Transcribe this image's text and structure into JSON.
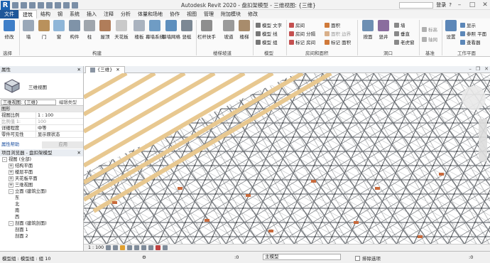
{
  "app": {
    "title": "Autodesk Revit 2020 - 盘扣架模型 - 三维视图: {三维}",
    "search_placeholder": "",
    "user": "登录",
    "help": "?"
  },
  "tabs": [
    "文件",
    "建筑",
    "结构",
    "钢",
    "系统",
    "插入",
    "注释",
    "分析",
    "体量和场地",
    "协作",
    "视图",
    "管理",
    "附加模块",
    "修改"
  ],
  "active_tab_index": 1,
  "ribbon": {
    "big_buttons": [
      "修改",
      "墙",
      "门",
      "窗",
      "构件",
      "柱",
      "屋顶",
      "天花板",
      "楼板",
      "幕墙系统",
      "幕墙网格",
      "竖梃",
      "栏杆扶手",
      "坡道",
      "楼梯",
      "按面",
      "竖井",
      "设置"
    ],
    "small_buttons": {
      "model": [
        "模型 文字",
        "模型 线",
        "模型 组"
      ],
      "room": [
        "房间",
        "房间 分隔",
        "标记 房间"
      ],
      "area": [
        "面积",
        "面积 边界",
        "标记 面积"
      ],
      "opening": [
        "墙",
        "垂直",
        "老虎窗"
      ],
      "datum": [
        "标高",
        "轴网"
      ],
      "workplane": [
        "显示",
        "参照 平面",
        "查看器"
      ]
    },
    "groups": [
      "选择",
      "构建",
      "楼梯坡道",
      "模型",
      "房间和面积",
      "洞口",
      "基准",
      "工作平面"
    ]
  },
  "properties": {
    "header": "属性",
    "type_name": "三维视图",
    "view_selector": "三维视图: {三维}",
    "edit_type": "编辑类型",
    "section": "图形",
    "rows": [
      {
        "k": "视图比例",
        "v": "1 : 100"
      },
      {
        "k": "比例值 1:",
        "v": "100"
      },
      {
        "k": "详细程度",
        "v": "中等"
      },
      {
        "k": "零件可见性",
        "v": "显示原状态"
      }
    ],
    "help_link": "属性帮助",
    "apply": "应用"
  },
  "browser": {
    "header": "项目浏览器 - 盘扣架模型",
    "nodes": [
      {
        "level": 0,
        "toggle": "-",
        "label": "视图 (全部)"
      },
      {
        "level": 1,
        "toggle": "+",
        "label": "结构平面"
      },
      {
        "level": 1,
        "toggle": "+",
        "label": "楼层平面"
      },
      {
        "level": 1,
        "toggle": "+",
        "label": "天花板平面"
      },
      {
        "level": 1,
        "toggle": "+",
        "label": "三维视图"
      },
      {
        "level": 1,
        "toggle": "-",
        "label": "立面 (建筑立面)"
      },
      {
        "level": 2,
        "toggle": "",
        "label": "东"
      },
      {
        "level": 2,
        "toggle": "",
        "label": "北"
      },
      {
        "level": 2,
        "toggle": "",
        "label": "南"
      },
      {
        "level": 2,
        "toggle": "",
        "label": "西"
      },
      {
        "level": 1,
        "toggle": "-",
        "label": "剖面 (建筑剖面)"
      },
      {
        "level": 2,
        "toggle": "",
        "label": "剖面 1"
      },
      {
        "level": 2,
        "toggle": "",
        "label": "剖面 2"
      }
    ]
  },
  "view_tab": "{三维}",
  "view_status": {
    "scale": "1 : 100"
  },
  "status_bar": {
    "left": "模型组 : 模型组 : 组 10",
    "count": ":0",
    "model": "主模型",
    "exclude": "排除选项",
    "filter": ":0"
  },
  "colors": {
    "accent": "#1e5799",
    "beam": "#e8c890",
    "scaffold": "#6b6f74",
    "node": "#c86a3c"
  }
}
